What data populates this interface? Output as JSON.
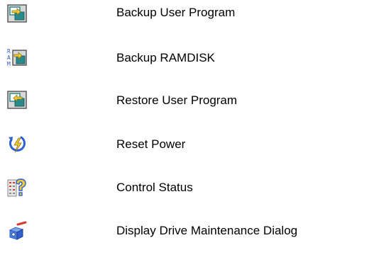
{
  "items": [
    {
      "label": "Backup User Program",
      "icon": "backup-user-program-icon"
    },
    {
      "label": "Backup RAMDISK",
      "icon": "backup-ramdisk-icon"
    },
    {
      "label": "Restore User Program",
      "icon": "restore-user-program-icon"
    },
    {
      "label": "Reset Power",
      "icon": "reset-power-icon"
    },
    {
      "label": "Control Status",
      "icon": "control-status-icon"
    },
    {
      "label": "Display Drive Maintenance Dialog",
      "icon": "drive-maintenance-icon"
    }
  ],
  "icon_text": {
    "ramdisk_letters": "RAM"
  },
  "colors": {
    "icon_frame": "#5a5a5a",
    "icon_fill": "#e8eef4",
    "arrow_yellow": "#f2cf2c",
    "teal": "#2a8a8a",
    "blue": "#2f5fd0",
    "red": "#d23b2f",
    "gray_box": "#c8c8c8"
  }
}
